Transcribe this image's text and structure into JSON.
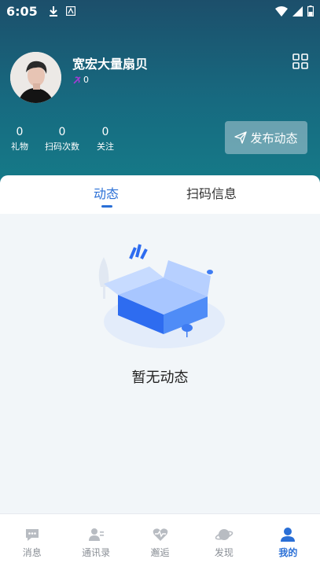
{
  "status_bar": {
    "time": "6:05"
  },
  "profile": {
    "username": "宽宏大量扇贝",
    "gift_count": "0"
  },
  "stats": [
    {
      "value": "0",
      "label": "礼物"
    },
    {
      "value": "0",
      "label": "扫码次数"
    },
    {
      "value": "0",
      "label": "关注"
    }
  ],
  "post_button_label": "发布动态",
  "tabs": [
    {
      "label": "动态",
      "active": true
    },
    {
      "label": "扫码信息",
      "active": false
    }
  ],
  "empty_state": {
    "text": "暂无动态"
  },
  "bottom_nav": [
    {
      "label": "消息",
      "icon": "chat-icon"
    },
    {
      "label": "通讯录",
      "icon": "contacts-icon"
    },
    {
      "label": "邂逅",
      "icon": "heart-pulse-icon"
    },
    {
      "label": "发现",
      "icon": "planet-icon"
    },
    {
      "label": "我的",
      "icon": "person-icon",
      "active": true
    }
  ],
  "colors": {
    "accent": "#2a6fd6",
    "header_top": "#1c4f6b",
    "header_bottom": "#157a88"
  }
}
